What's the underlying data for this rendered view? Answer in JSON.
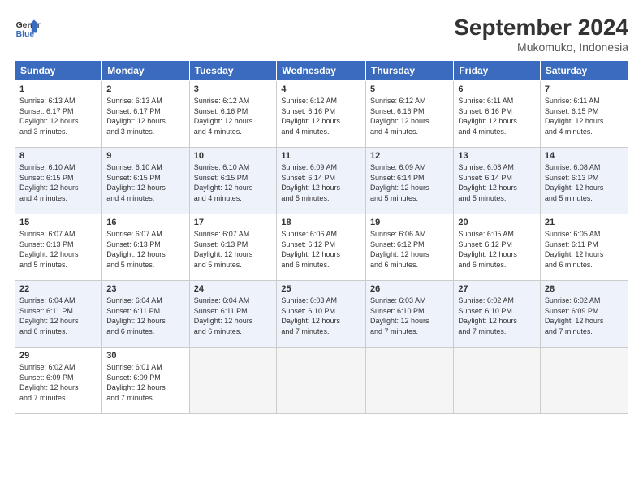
{
  "header": {
    "logo_line1": "General",
    "logo_line2": "Blue",
    "month": "September 2024",
    "location": "Mukomuko, Indonesia"
  },
  "weekdays": [
    "Sunday",
    "Monday",
    "Tuesday",
    "Wednesday",
    "Thursday",
    "Friday",
    "Saturday"
  ],
  "weeks": [
    [
      {
        "day": "1",
        "info": "Sunrise: 6:13 AM\nSunset: 6:17 PM\nDaylight: 12 hours\nand 3 minutes."
      },
      {
        "day": "2",
        "info": "Sunrise: 6:13 AM\nSunset: 6:17 PM\nDaylight: 12 hours\nand 3 minutes."
      },
      {
        "day": "3",
        "info": "Sunrise: 6:12 AM\nSunset: 6:16 PM\nDaylight: 12 hours\nand 4 minutes."
      },
      {
        "day": "4",
        "info": "Sunrise: 6:12 AM\nSunset: 6:16 PM\nDaylight: 12 hours\nand 4 minutes."
      },
      {
        "day": "5",
        "info": "Sunrise: 6:12 AM\nSunset: 6:16 PM\nDaylight: 12 hours\nand 4 minutes."
      },
      {
        "day": "6",
        "info": "Sunrise: 6:11 AM\nSunset: 6:16 PM\nDaylight: 12 hours\nand 4 minutes."
      },
      {
        "day": "7",
        "info": "Sunrise: 6:11 AM\nSunset: 6:15 PM\nDaylight: 12 hours\nand 4 minutes."
      }
    ],
    [
      {
        "day": "8",
        "info": "Sunrise: 6:10 AM\nSunset: 6:15 PM\nDaylight: 12 hours\nand 4 minutes."
      },
      {
        "day": "9",
        "info": "Sunrise: 6:10 AM\nSunset: 6:15 PM\nDaylight: 12 hours\nand 4 minutes."
      },
      {
        "day": "10",
        "info": "Sunrise: 6:10 AM\nSunset: 6:15 PM\nDaylight: 12 hours\nand 4 minutes."
      },
      {
        "day": "11",
        "info": "Sunrise: 6:09 AM\nSunset: 6:14 PM\nDaylight: 12 hours\nand 5 minutes."
      },
      {
        "day": "12",
        "info": "Sunrise: 6:09 AM\nSunset: 6:14 PM\nDaylight: 12 hours\nand 5 minutes."
      },
      {
        "day": "13",
        "info": "Sunrise: 6:08 AM\nSunset: 6:14 PM\nDaylight: 12 hours\nand 5 minutes."
      },
      {
        "day": "14",
        "info": "Sunrise: 6:08 AM\nSunset: 6:13 PM\nDaylight: 12 hours\nand 5 minutes."
      }
    ],
    [
      {
        "day": "15",
        "info": "Sunrise: 6:07 AM\nSunset: 6:13 PM\nDaylight: 12 hours\nand 5 minutes."
      },
      {
        "day": "16",
        "info": "Sunrise: 6:07 AM\nSunset: 6:13 PM\nDaylight: 12 hours\nand 5 minutes."
      },
      {
        "day": "17",
        "info": "Sunrise: 6:07 AM\nSunset: 6:13 PM\nDaylight: 12 hours\nand 5 minutes."
      },
      {
        "day": "18",
        "info": "Sunrise: 6:06 AM\nSunset: 6:12 PM\nDaylight: 12 hours\nand 6 minutes."
      },
      {
        "day": "19",
        "info": "Sunrise: 6:06 AM\nSunset: 6:12 PM\nDaylight: 12 hours\nand 6 minutes."
      },
      {
        "day": "20",
        "info": "Sunrise: 6:05 AM\nSunset: 6:12 PM\nDaylight: 12 hours\nand 6 minutes."
      },
      {
        "day": "21",
        "info": "Sunrise: 6:05 AM\nSunset: 6:11 PM\nDaylight: 12 hours\nand 6 minutes."
      }
    ],
    [
      {
        "day": "22",
        "info": "Sunrise: 6:04 AM\nSunset: 6:11 PM\nDaylight: 12 hours\nand 6 minutes."
      },
      {
        "day": "23",
        "info": "Sunrise: 6:04 AM\nSunset: 6:11 PM\nDaylight: 12 hours\nand 6 minutes."
      },
      {
        "day": "24",
        "info": "Sunrise: 6:04 AM\nSunset: 6:11 PM\nDaylight: 12 hours\nand 6 minutes."
      },
      {
        "day": "25",
        "info": "Sunrise: 6:03 AM\nSunset: 6:10 PM\nDaylight: 12 hours\nand 7 minutes."
      },
      {
        "day": "26",
        "info": "Sunrise: 6:03 AM\nSunset: 6:10 PM\nDaylight: 12 hours\nand 7 minutes."
      },
      {
        "day": "27",
        "info": "Sunrise: 6:02 AM\nSunset: 6:10 PM\nDaylight: 12 hours\nand 7 minutes."
      },
      {
        "day": "28",
        "info": "Sunrise: 6:02 AM\nSunset: 6:09 PM\nDaylight: 12 hours\nand 7 minutes."
      }
    ],
    [
      {
        "day": "29",
        "info": "Sunrise: 6:02 AM\nSunset: 6:09 PM\nDaylight: 12 hours\nand 7 minutes."
      },
      {
        "day": "30",
        "info": "Sunrise: 6:01 AM\nSunset: 6:09 PM\nDaylight: 12 hours\nand 7 minutes."
      },
      {
        "day": "",
        "info": ""
      },
      {
        "day": "",
        "info": ""
      },
      {
        "day": "",
        "info": ""
      },
      {
        "day": "",
        "info": ""
      },
      {
        "day": "",
        "info": ""
      }
    ]
  ]
}
